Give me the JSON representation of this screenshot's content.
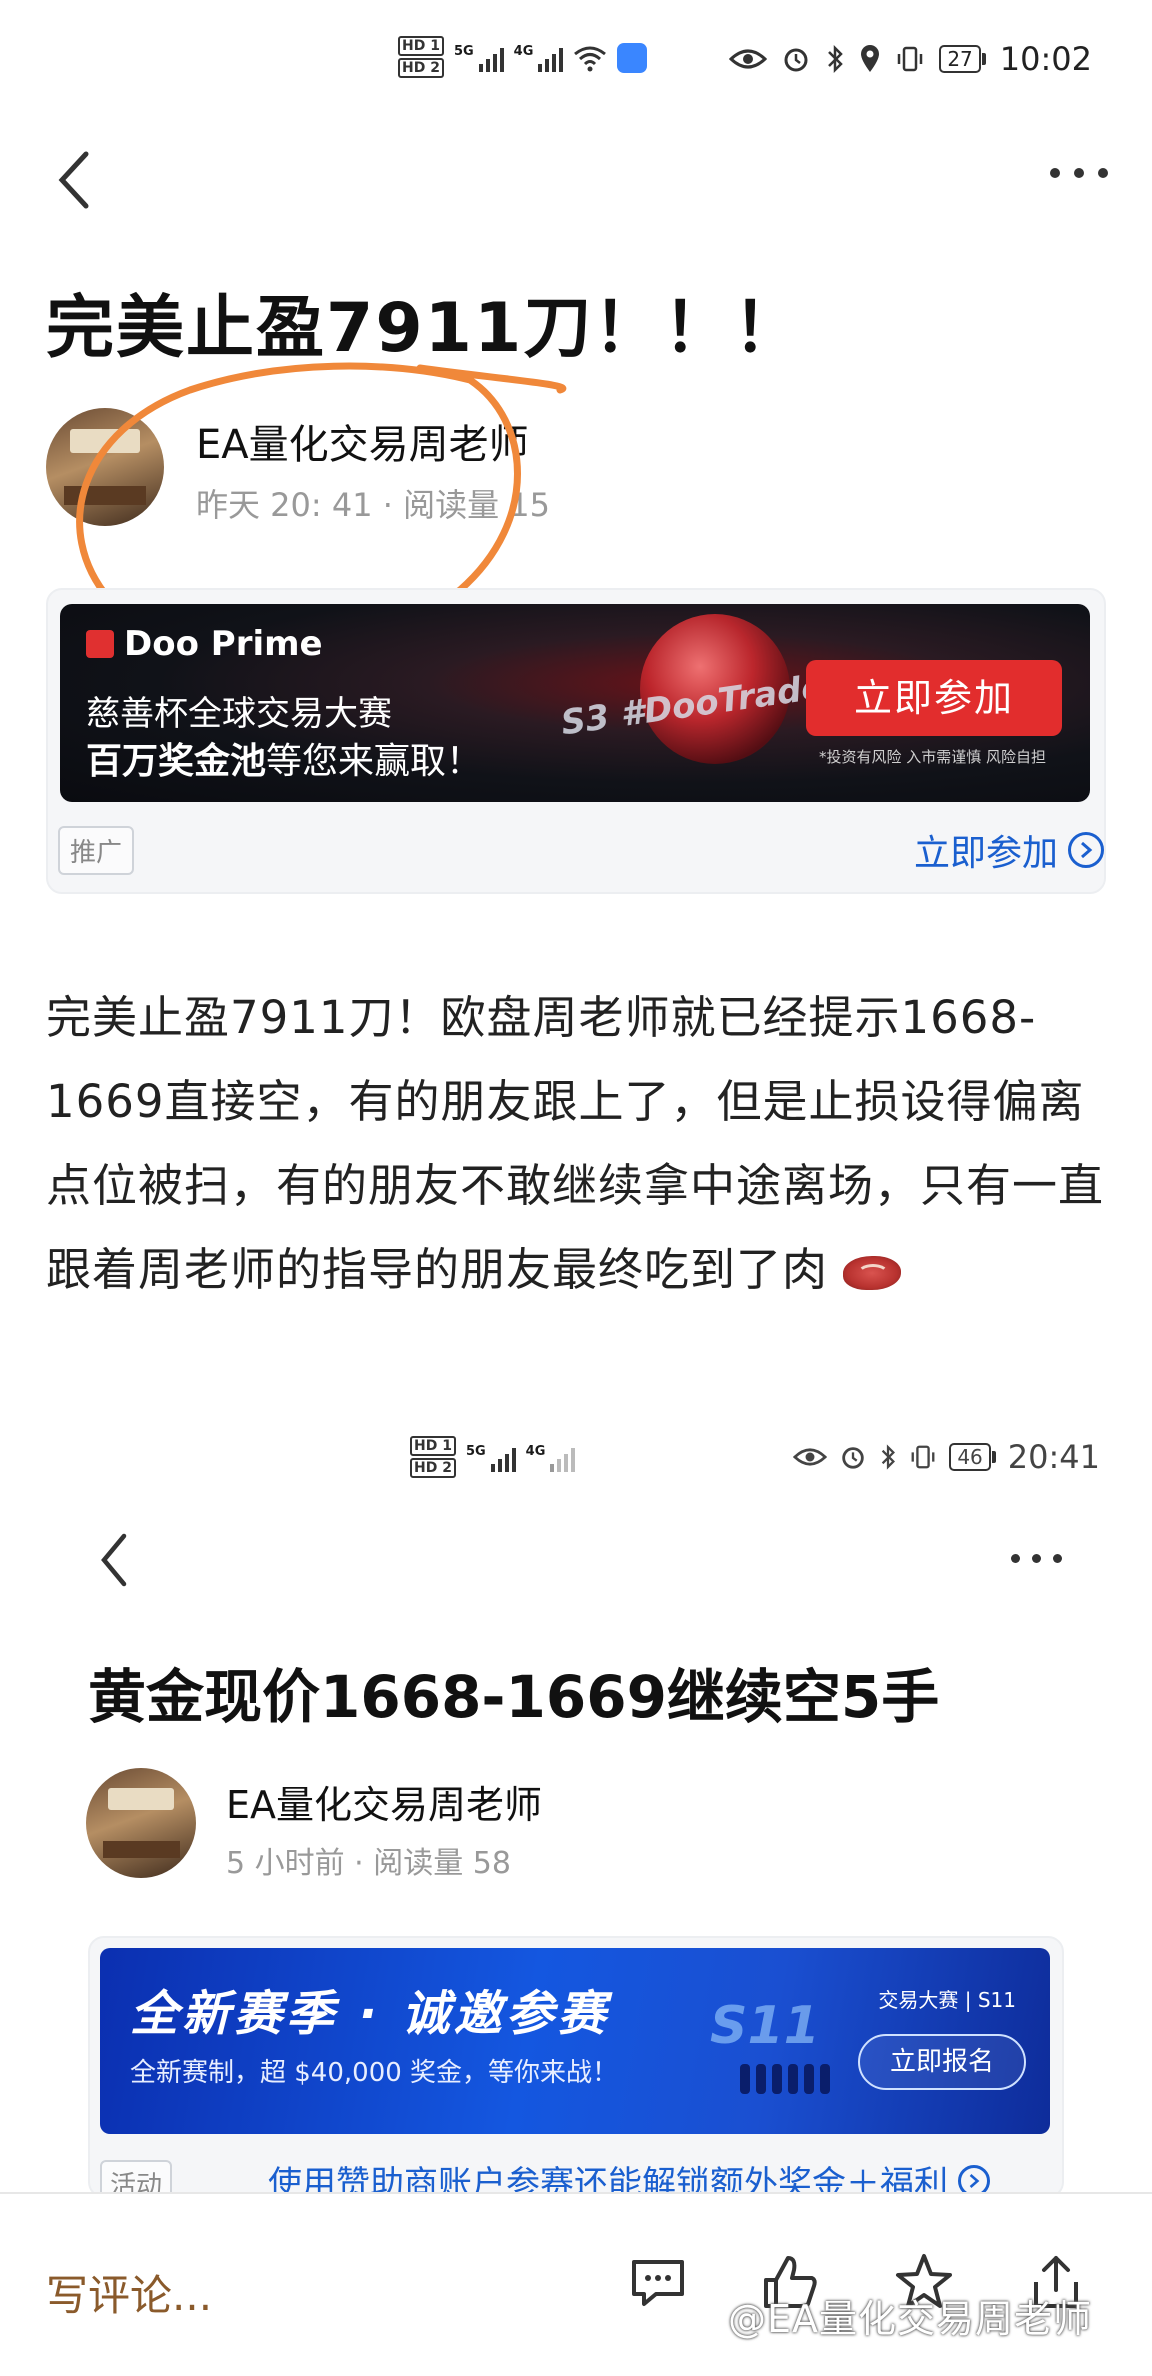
{
  "status_bar_1": {
    "time": "10:02",
    "battery": "27",
    "sim1": "HD 1",
    "sim2": "HD 2",
    "net1": "5G",
    "net2": "4G"
  },
  "post1": {
    "title": "完美止盈7911刀！！！",
    "author": "EA量化交易周老师",
    "meta": "昨天 20: 41 · 阅读量 15",
    "body": "完美止盈7911刀！欧盘周老师就已经提示1668-1669直接空，有的朋友跟上了，但是止损设得偏离点位被扫，有的朋友不敢继续拿中途离场，只有一直跟着周老师的指导的朋友最终吃到了肉"
  },
  "ad1": {
    "brand": "Doo Prime",
    "line1": "慈善杯全球交易大赛",
    "line2_bold": "百万奖金池",
    "line2_rest": "等您来赢取！",
    "hashtag": "S3 #DooTrader",
    "cta": "立即参加",
    "risk": "*投资有风险 入市需谨慎 风险自担",
    "tag": "推广",
    "link": "立即参加"
  },
  "status_bar_2": {
    "time": "20:41",
    "battery": "46",
    "sim1": "HD 1",
    "sim2": "HD 2",
    "net1": "5G",
    "net2": "4G"
  },
  "post2": {
    "title": "黄金现价1668-1669继续空5手",
    "author": "EA量化交易周老师",
    "meta": "5 小时前 · 阅读量 58"
  },
  "ad2": {
    "headline": "全新赛季 · 诚邀参赛",
    "sub": "全新赛制，超 $40,000 奖金，等你来战！",
    "brand": "交易大赛 | S11",
    "season": "S11",
    "cta": "立即报名",
    "tag": "活动",
    "link": "使用赞助商账户参赛还能解锁额外奖金＋福利"
  },
  "bottom_bar": {
    "comment_placeholder": "写评论...",
    "watermark": "@EA量化交易周老师"
  },
  "colors": {
    "link_blue": "#1a5fcf",
    "cta_red": "#e22d2d",
    "comment_brown": "#8a5a2b",
    "annotation_orange": "#f0883a"
  }
}
